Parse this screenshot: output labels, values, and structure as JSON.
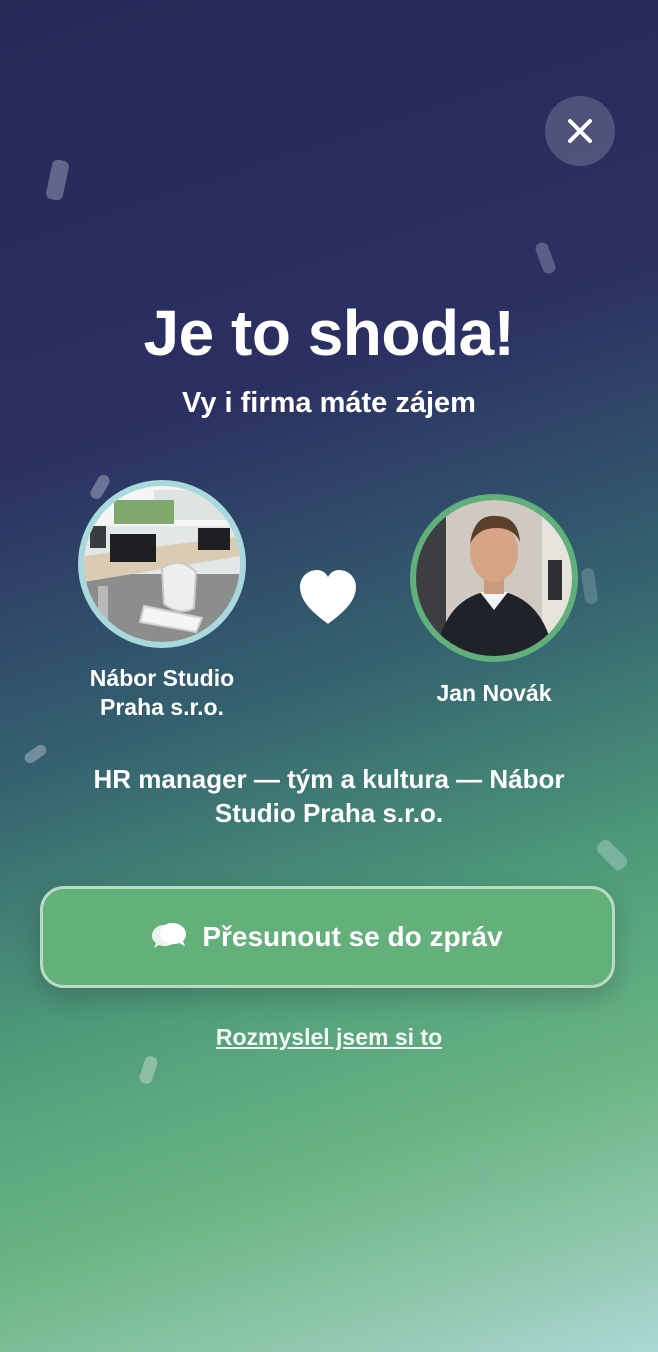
{
  "match": {
    "title": "Je to shoda!",
    "subtitle": "Vy i firma máte zájem",
    "company_name_line1": "Nábor Studio",
    "company_name_line2": "Praha s.r.o.",
    "candidate_name": "Jan Novák",
    "position_line1": "HR manager — tým a kultura — Nábor",
    "position_line2": "Studio Praha s.r.o."
  },
  "actions": {
    "primary_label": "Přesunout se do zpráv",
    "secondary_label": "Rozmyslel jsem si to"
  },
  "icons": {
    "close": "close-icon",
    "heart": "heart-icon",
    "chat": "chat-bubbles-icon"
  },
  "colors": {
    "accent_green": "#64b07b",
    "company_ring": "#a9d9dc",
    "candidate_ring": "#5fb07a",
    "background_top": "#262a57",
    "background_bottom": "#acd7d6"
  }
}
